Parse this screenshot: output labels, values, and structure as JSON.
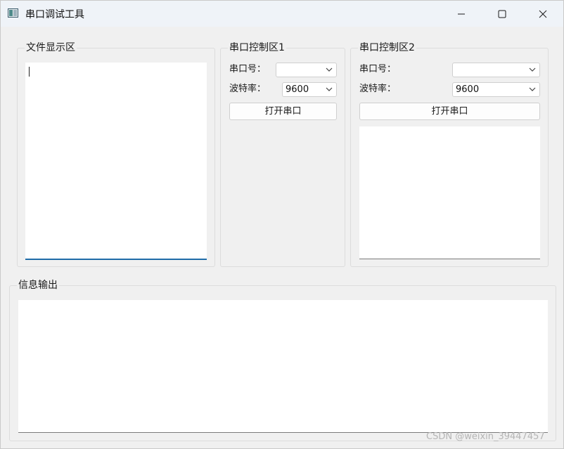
{
  "window": {
    "title": "串口调试工具",
    "icons": {
      "app": "app-window-icon",
      "minimize": "minimize-icon",
      "maximize": "maximize-icon",
      "close": "close-icon"
    }
  },
  "file_panel": {
    "title": "文件显示区",
    "content": ""
  },
  "serial1": {
    "title": "串口控制区1",
    "port_label": "串口号：",
    "port_value": "",
    "baud_label": "波特率：",
    "baud_value": "9600",
    "open_button": "打开串口"
  },
  "serial2": {
    "title": "串口控制区2",
    "port_label": "串口号：",
    "port_value": "",
    "baud_label": "波特率：",
    "baud_value": "9600",
    "open_button": "打开串口",
    "receive_content": ""
  },
  "info_panel": {
    "title": "信息输出",
    "content": ""
  },
  "watermark": "CSDN @weixin_39447457",
  "colors": {
    "titlebar": "#eff3f8",
    "background": "#f0f0f0",
    "focus_accent": "#1f6ca8"
  }
}
